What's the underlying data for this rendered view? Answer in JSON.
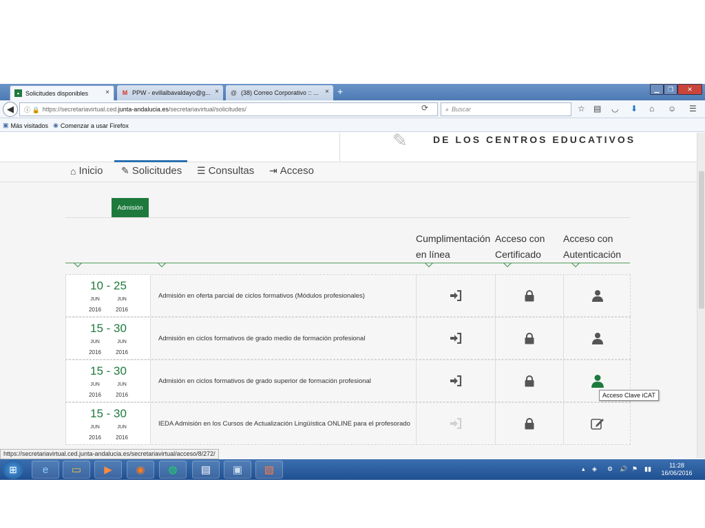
{
  "browser": {
    "tabs": [
      {
        "label": "Solicitudes disponibles",
        "close": "×"
      },
      {
        "label": "PPW - evillalbavaldayo@g...",
        "close": "×"
      },
      {
        "label": "(38) Correo Corporativo :: ...",
        "close": "×"
      }
    ],
    "new_tab": "+",
    "url_prefix": "https://secretariavirtual.ced.",
    "url_host": "junta-andalucia.es",
    "url_path": "/secretariavirtual/solicitudes/",
    "search_placeholder": "Buscar",
    "bookmarks": [
      "Más visitados",
      "Comenzar a usar Firefox"
    ]
  },
  "header": {
    "title": "DE LOS CENTROS EDUCATIVOS"
  },
  "nav": {
    "items": [
      "Inicio",
      "Solicitudes",
      "Consultas",
      "Acceso"
    ],
    "active": "Solicitudes"
  },
  "subtab": "Admisión",
  "columns": {
    "online": [
      "Cumplimentación",
      "en línea"
    ],
    "cert": [
      "Acceso con",
      "Certificado"
    ],
    "auth": [
      "Acceso con",
      "Autenticación"
    ]
  },
  "rows": [
    {
      "range": "10 - 25",
      "m1": "JUN",
      "m2": "JUN",
      "y1": "2016",
      "y2": "2016",
      "desc": "Admisión en oferta parcial de ciclos formativos (Módulos profesionales)",
      "online": "enabled",
      "auth_icon": "user-icon-grey"
    },
    {
      "range": "15 - 30",
      "m1": "JUN",
      "m2": "JUN",
      "y1": "2016",
      "y2": "2016",
      "desc": "Admisión en ciclos formativos de grado medio de formación profesional",
      "online": "enabled",
      "auth_icon": "user-icon-grey"
    },
    {
      "range": "15 - 30",
      "m1": "JUN",
      "m2": "JUN",
      "y1": "2016",
      "y2": "2016",
      "desc": "Admisión en ciclos formativos de grado superior de formación profesional",
      "online": "enabled",
      "auth_icon": "user-icon-green"
    },
    {
      "range": "15 - 30",
      "m1": "JUN",
      "m2": "JUN",
      "y1": "2016",
      "y2": "2016",
      "desc": "IEDA Admisión en los Cursos de Actualización Lingüística ONLINE para el profesorado",
      "online": "disabled",
      "auth_icon": "edit-icon"
    }
  ],
  "tooltip": "Acceso Clave iCAT",
  "status_url": "https://secretariavirtual.ced.junta-andalucia.es/secretariavirtual/acceso/8/272/",
  "clock": {
    "time": "11:28",
    "date": "16/06/2016"
  },
  "colors": {
    "green": "#1e7a3c",
    "icon_grey": "#555555",
    "taskbar": "#1f4f91"
  }
}
